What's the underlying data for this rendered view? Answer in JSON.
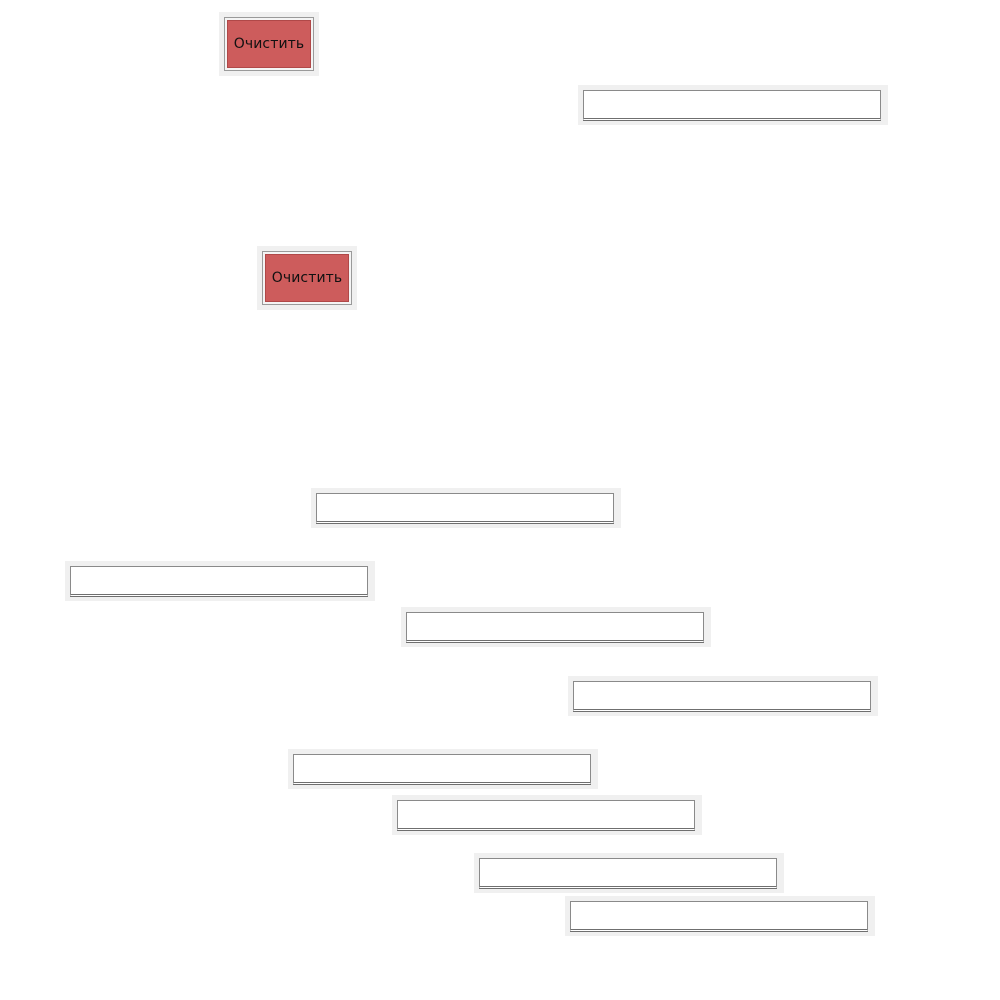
{
  "buttons": {
    "clear_1": {
      "label": "Очистить"
    },
    "clear_2": {
      "label": "Очистить"
    }
  },
  "fields": {
    "field_1": {
      "value": "",
      "placeholder": ""
    },
    "field_2": {
      "value": "",
      "placeholder": ""
    },
    "field_3": {
      "value": "",
      "placeholder": ""
    },
    "field_4": {
      "value": "",
      "placeholder": ""
    },
    "field_5": {
      "value": "",
      "placeholder": ""
    },
    "field_6": {
      "value": "",
      "placeholder": ""
    },
    "field_7": {
      "value": "",
      "placeholder": ""
    },
    "field_8": {
      "value": "",
      "placeholder": ""
    },
    "field_9": {
      "value": "",
      "placeholder": ""
    }
  },
  "colors": {
    "button_fill": "#cd5c5c",
    "panel_bg": "#f0f0f0",
    "field_border": "#8a8a8a"
  }
}
